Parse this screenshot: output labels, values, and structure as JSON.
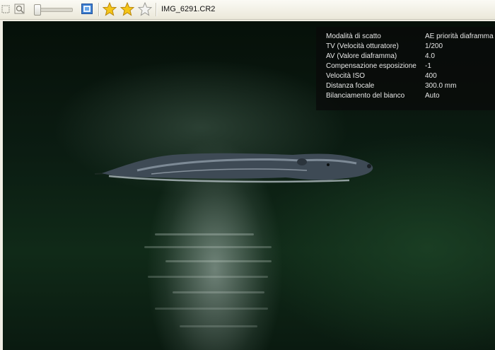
{
  "toolbar": {
    "icons": [
      "fit-to-window-icon",
      "zoom-icon",
      "zoom-slider",
      "fullscreen-icon"
    ],
    "zoom_level": 0,
    "rating": {
      "filled": 2,
      "total": 3
    },
    "filename": "IMG_6291.CR2"
  },
  "exif": {
    "rows": [
      {
        "label": "Modalità di scatto",
        "value": "AE priorità diaframma"
      },
      {
        "label": "TV (Velocità otturatore)",
        "value": "1/200"
      },
      {
        "label": "AV (Valore diaframma)",
        "value": "4.0"
      },
      {
        "label": "Compensazione esposizione",
        "value": "-1"
      },
      {
        "label": "Velocità ISO",
        "value": "400"
      },
      {
        "label": "Distanza focale",
        "value": "300.0 mm"
      },
      {
        "label": "Bilanciamento del bianco",
        "value": "Auto"
      }
    ]
  },
  "colors": {
    "toolbar_bg": "#ece9d8",
    "star_fill": "#f2c200",
    "exif_bg": "#0a0a0a"
  }
}
